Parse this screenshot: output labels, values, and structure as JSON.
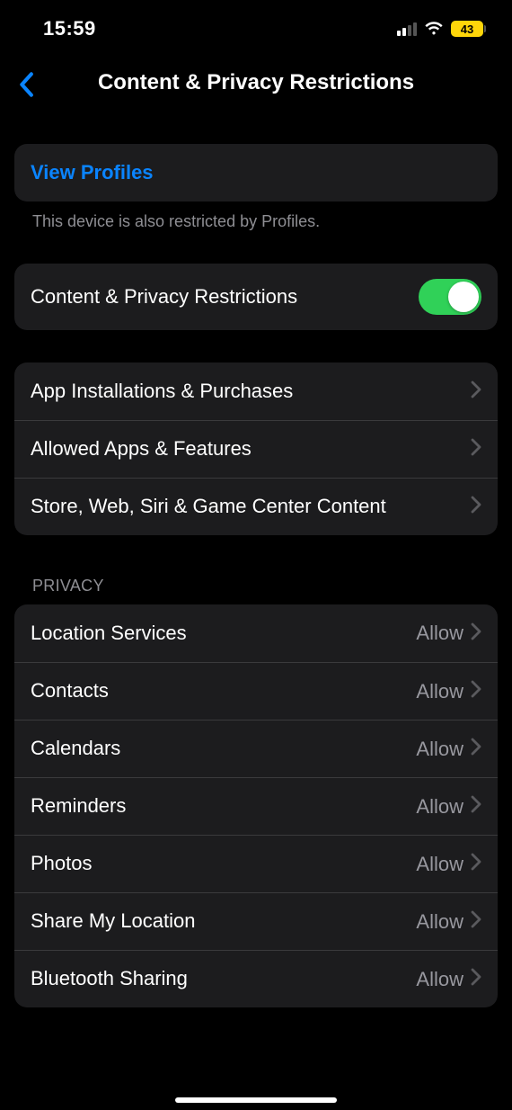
{
  "status": {
    "time": "15:59",
    "battery": "43"
  },
  "nav": {
    "title": "Content & Privacy Restrictions"
  },
  "profiles": {
    "link": "View Profiles",
    "footer": "This device is also restricted by Profiles."
  },
  "toggle_row": {
    "label": "Content & Privacy Restrictions",
    "on": true
  },
  "main_group": [
    {
      "label": "App Installations & Purchases"
    },
    {
      "label": "Allowed Apps & Features"
    },
    {
      "label": "Store, Web, Siri & Game Center Content"
    }
  ],
  "privacy": {
    "header": "PRIVACY",
    "value_allow": "Allow",
    "items": [
      {
        "label": "Location Services",
        "value": "Allow"
      },
      {
        "label": "Contacts",
        "value": "Allow"
      },
      {
        "label": "Calendars",
        "value": "Allow"
      },
      {
        "label": "Reminders",
        "value": "Allow"
      },
      {
        "label": "Photos",
        "value": "Allow"
      },
      {
        "label": "Share My Location",
        "value": "Allow"
      },
      {
        "label": "Bluetooth Sharing",
        "value": "Allow"
      }
    ]
  }
}
